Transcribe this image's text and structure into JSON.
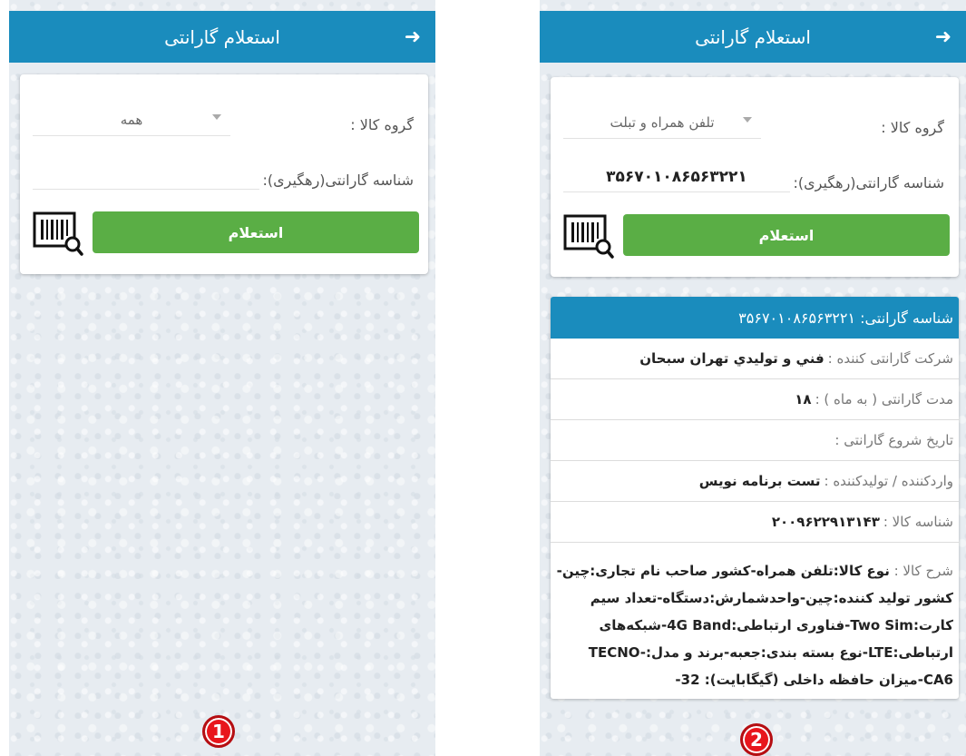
{
  "screen1": {
    "header": {
      "title": "استعلام گارانتی",
      "back_icon": "arrow-right-icon"
    },
    "form": {
      "group_label": "گروه کالا :",
      "group_value": "همه",
      "id_label": "شناسه گارانتی(رهگیری):",
      "id_value": "",
      "button_label": "استعلام"
    },
    "badge": "1"
  },
  "screen2": {
    "header": {
      "title": "استعلام گارانتی",
      "back_icon": "arrow-right-icon"
    },
    "form": {
      "group_label": "گروه کالا :",
      "group_value": "تلفن همراه و تبلت",
      "id_label": "شناسه گارانتی(رهگیری):",
      "id_value": "۳۵۶۷۰۱۰۸۶۵۶۳۲۲۱",
      "button_label": "استعلام"
    },
    "result": {
      "title": "شناسه گارانتی: ۳۵۶۷۰۱۰۸۶۵۶۳۲۲۱",
      "rows": [
        {
          "k": "شرکت گارانتی کننده : ",
          "v": "فني و توليدي تهران سبحان"
        },
        {
          "k": "مدت گارانتی ( به ماه ) : ",
          "v": "۱۸"
        },
        {
          "k": "تاریخ شروع گارانتی : ",
          "v": ""
        },
        {
          "k": "واردکننده / تولیدکننده : ",
          "v": "تست برنامه نویس"
        },
        {
          "k": "شناسه کالا : ",
          "v": "۲۰۰۹۶۲۲۹۱۳۱۴۳"
        }
      ],
      "desc_key": "شرح کالا : ",
      "desc_value": "نوع کالا:تلفن همراه-کشور صاحب نام تجاری:چین-کشور تولید کننده:چین-واحدشمارش:دستگاه-تعداد سیم کارت:Two Sim-فناوری ارتباطی:4G Band-شبکه‌های ارتباطی:LTE-نوع بسته بندی:جعبه-برند و مدل:TECNO-CA6-میزان حافظه داخلی (گیگابایت): 32-"
    },
    "badge": "2"
  },
  "colors": {
    "header": "#1a8cbd",
    "button": "#5aae45",
    "badge": "#e8161c"
  }
}
